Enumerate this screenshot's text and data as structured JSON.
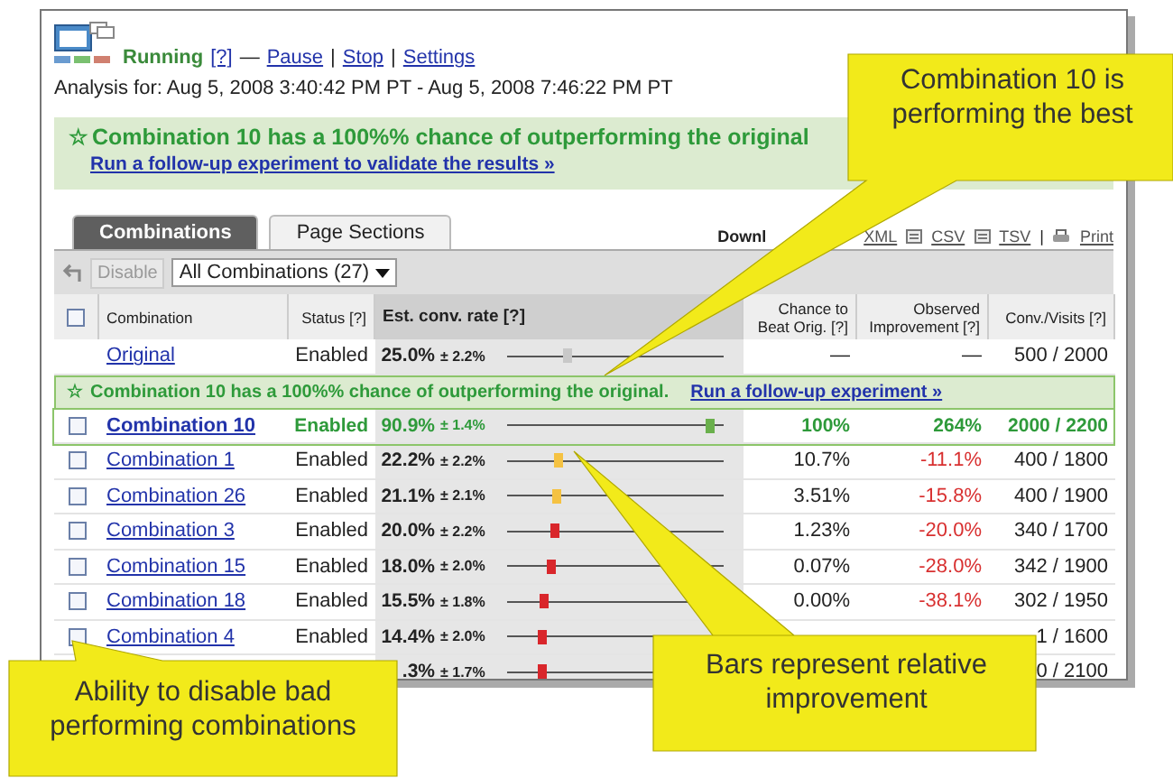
{
  "header": {
    "status": "Running",
    "status_help": "[?]",
    "separator": "—",
    "actions": [
      "Pause",
      "Stop",
      "Settings"
    ],
    "action_separator": "|",
    "analysis": "Analysis for: Aug 5, 2008 3:40:42 PM PT - Aug 5, 2008 7:46:22 PM PT"
  },
  "banner": {
    "icon": "☆",
    "headline": "Combination 10 has a 100%% chance of outperforming the original",
    "link": "Run a follow-up experiment to validate the results »"
  },
  "tabs": [
    {
      "label": "Combinations",
      "selected": true
    },
    {
      "label": "Page Sections",
      "selected": false
    }
  ],
  "downloads": {
    "label": "Downl",
    "links": [
      {
        "label": "XML",
        "kind": "plain"
      },
      {
        "label": "CSV",
        "kind": "csv"
      },
      {
        "label": "TSV",
        "kind": "tsv"
      },
      {
        "label": "Print",
        "kind": "print"
      }
    ],
    "separator": "|"
  },
  "toolbar": {
    "disable_button": {
      "label": "Disable",
      "disabled": true
    },
    "filter": "All Combinations (27)"
  },
  "table": {
    "select_all_checked": false,
    "columns": [
      "Combination",
      "Status [?]",
      "Est. conv. rate [?]",
      "Chance to Beat Orig. [?]",
      "Observed Improvement [?]",
      "Conv./Visits [?]"
    ],
    "inline_banner": {
      "icon": "☆",
      "text": "Combination 10 has a 100%% chance of outperforming the original.",
      "link": "Run a follow-up experiment »"
    },
    "rows": [
      {
        "kind": "original",
        "name": "Original",
        "status": "Enabled",
        "rate": "25.0%",
        "margin": "± 2.2%",
        "level": 0.27,
        "color": "#c8c8c8",
        "chance": "—",
        "improvement": "—",
        "conv": "500 / 2000"
      },
      {
        "kind": "winner",
        "checked": false,
        "name": "Combination 10",
        "status": "Enabled",
        "rate": "90.9%",
        "margin": "± 1.4%",
        "level": 0.96,
        "color": "#6ab04c",
        "chance": "100%",
        "improvement": "264%",
        "conv": "2000 / 2200"
      },
      {
        "kind": "normal",
        "checked": false,
        "name": "Combination 1",
        "status": "Enabled",
        "rate": "22.2%",
        "margin": "± 2.2%",
        "level": 0.23,
        "color": "#f5c242",
        "chance": "10.7%",
        "improvement": "-11.1%",
        "conv": "400 / 1800"
      },
      {
        "kind": "normal",
        "checked": false,
        "name": "Combination 26",
        "status": "Enabled",
        "rate": "21.1%",
        "margin": "± 2.1%",
        "level": 0.22,
        "color": "#f5c242",
        "chance": "3.51%",
        "improvement": "-15.8%",
        "conv": "400 / 1900"
      },
      {
        "kind": "normal",
        "checked": false,
        "name": "Combination 3",
        "status": "Enabled",
        "rate": "20.0%",
        "margin": "± 2.2%",
        "level": 0.21,
        "color": "#d9262b",
        "chance": "1.23%",
        "improvement": "-20.0%",
        "conv": "340 / 1700"
      },
      {
        "kind": "normal",
        "checked": false,
        "name": "Combination 15",
        "status": "Enabled",
        "rate": "18.0%",
        "margin": "± 2.0%",
        "level": 0.19,
        "color": "#d9262b",
        "chance": "0.07%",
        "improvement": "-28.0%",
        "conv": "342 / 1900"
      },
      {
        "kind": "normal",
        "checked": false,
        "name": "Combination 18",
        "status": "Enabled",
        "rate": "15.5%",
        "margin": "± 1.8%",
        "level": 0.16,
        "color": "#d9262b",
        "chance": "0.00%",
        "improvement": "-38.1%",
        "conv": "302 / 1950"
      },
      {
        "kind": "normal",
        "checked": false,
        "name": "Combination 4",
        "status": "Enabled",
        "rate": "14.4%",
        "margin": "± 2.0%",
        "level": 0.15,
        "color": "#d9262b",
        "conv": "1 / 1600"
      },
      {
        "kind": "normal",
        "rate": ".3%",
        "margin": "± 1.7%",
        "level": 0.15,
        "color": "#d9262b",
        "conv": "0 / 2100"
      }
    ]
  },
  "callouts": [
    {
      "kind": "top",
      "text": "Combination 10 is performing the best"
    },
    {
      "kind": "right",
      "text": "Bars represent relative improvement"
    },
    {
      "kind": "left",
      "text": "Ability to disable bad performing combinations"
    }
  ]
}
